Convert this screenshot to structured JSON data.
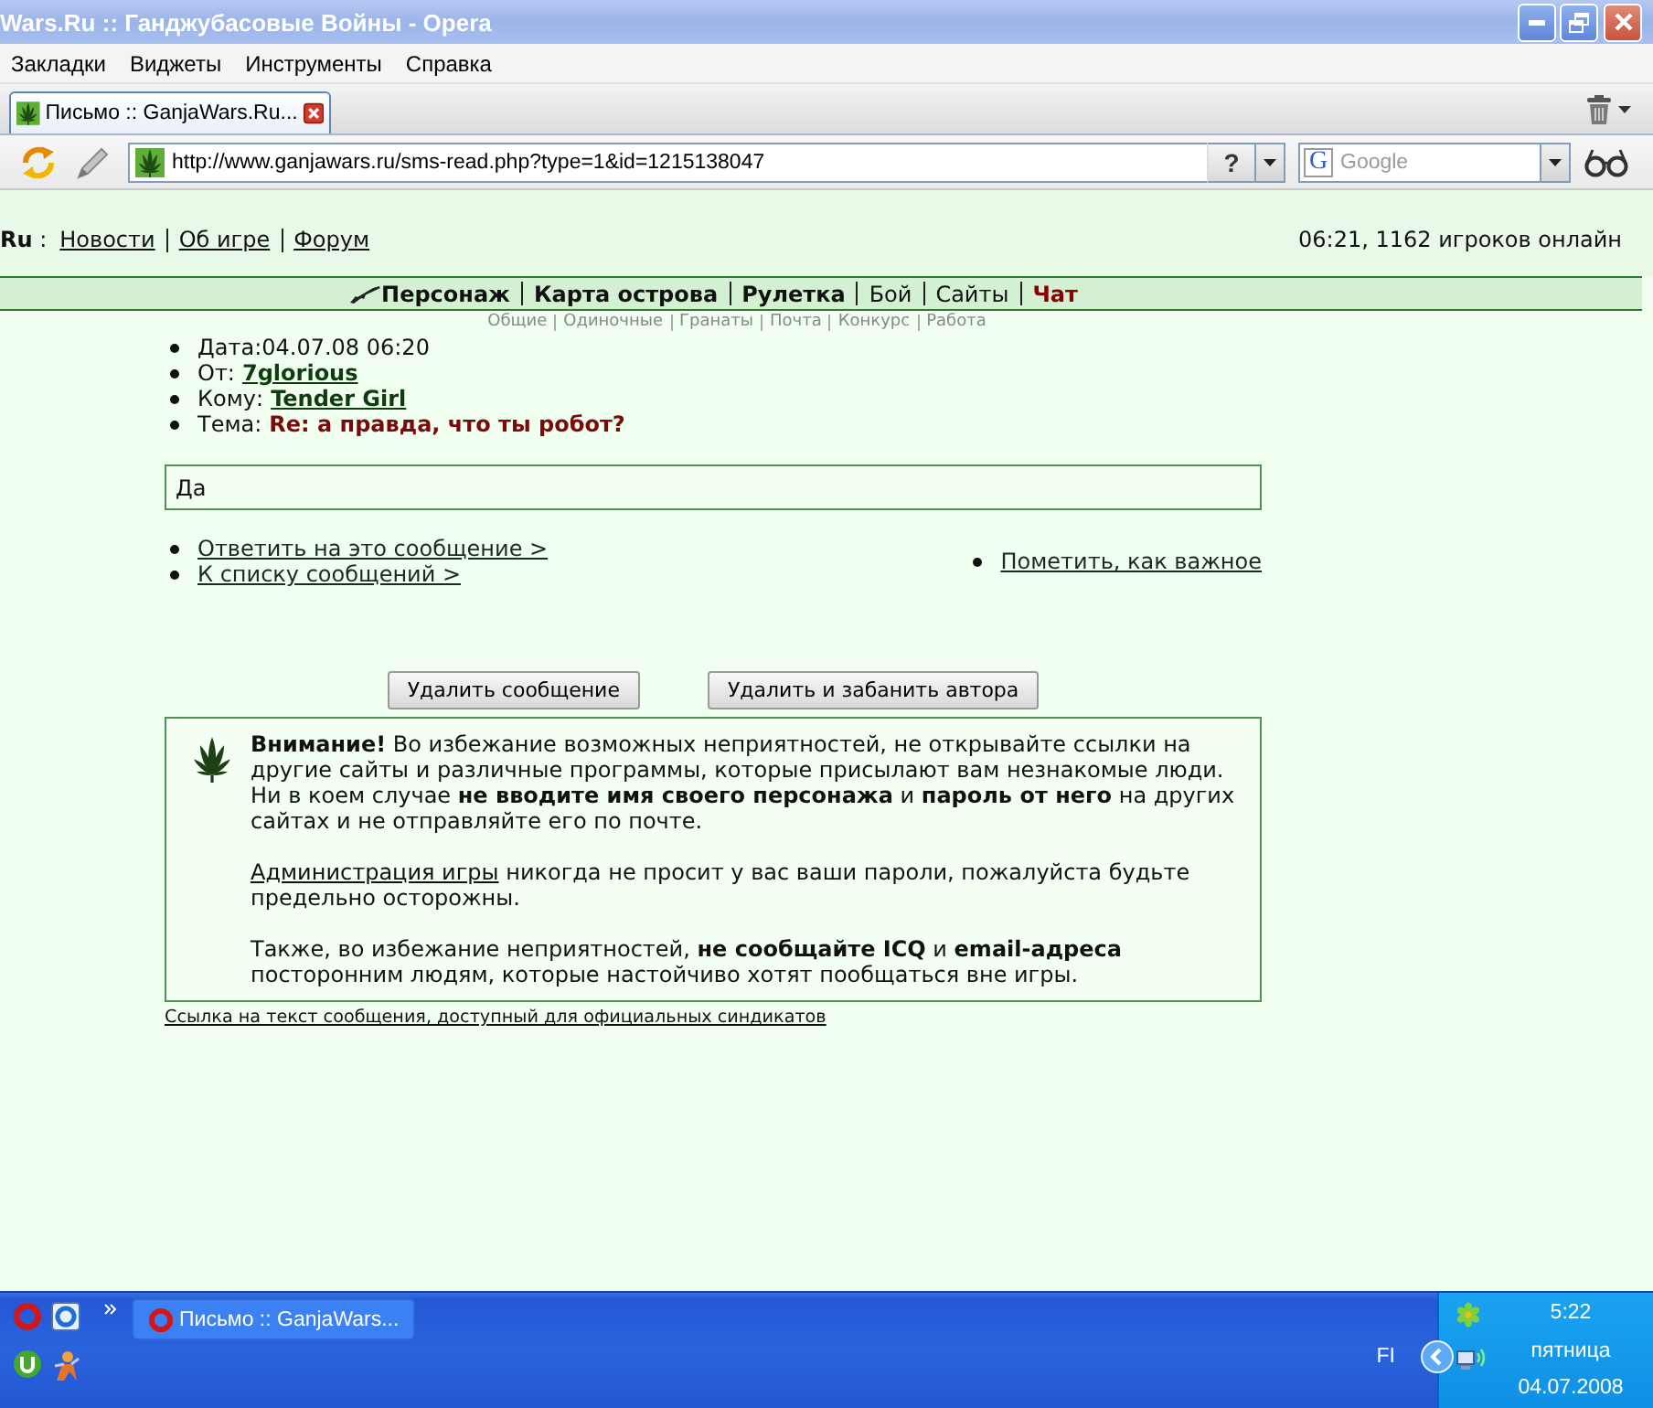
{
  "window": {
    "title": "Wars.Ru :: Ганджубасовые Войны - Opera",
    "active": false
  },
  "menu": [
    "Закладки",
    "Виджеты",
    "Инструменты",
    "Справка"
  ],
  "tabs": [
    {
      "label": "Письмо :: GanjaWars.Ru...",
      "selected": true
    }
  ],
  "address_bar": {
    "url": "http://www.ganjawars.ru/sms-read.php?type=1&id=1215138047",
    "help_button": "?"
  },
  "search": {
    "logo": "G",
    "placeholder": "Google"
  },
  "header": {
    "site": "**Ru** :",
    "links": [
      "Новости",
      "Об игре",
      "Форум"
    ],
    "status": "06:21, 1162 игроков онлайн"
  },
  "nav": {
    "items": [
      {
        "label": "Персонаж",
        "kind": "bold"
      },
      {
        "label": "Карта острова",
        "kind": "bold"
      },
      {
        "label": "Рулетка",
        "kind": "bold"
      },
      {
        "label": "Бой",
        "kind": "plain"
      },
      {
        "label": "Сайты",
        "kind": "plain"
      },
      {
        "label": "Чат",
        "kind": "alert"
      }
    ],
    "subitems": [
      "Общие",
      "Одиночные",
      "Гранаты",
      "Почта",
      "Конкурс",
      "Работа"
    ]
  },
  "message": {
    "fields": [
      {
        "kind": "plain",
        "text": "Дата:04.07.08 06:20"
      },
      {
        "kind": "user",
        "label": "От:",
        "value": "7glorious"
      },
      {
        "kind": "user",
        "label": "Кому:",
        "value": "Tender Girl"
      },
      {
        "kind": "subject",
        "label": "Тема:",
        "value": "Re: а правда, что ты робот?"
      }
    ],
    "body": "Да"
  },
  "actions": {
    "left": [
      "Ответить на это сообщение >",
      "К списку сообщений >"
    ],
    "right": [
      "Пометить, как важное"
    ]
  },
  "buttons": [
    "Удалить сообщение",
    "Удалить и забанить автора"
  ],
  "warning": {
    "paragraphs": [
      {
        "text": "**Внимание!** Во избежание возможных неприятностей, не открывайте ссылки на другие сайты и различные программы, которые присылают вам незнакомые люди. Ни в коем случае **не вводите имя своего персонажа** и **пароль от него** на других сайтах и не отправляйте его по почте."
      },
      {
        "link": "Администрация игры",
        "text": "никогда не просит у вас ваши пароли, пожалуйста будьте предельно осторожны."
      },
      {
        "text": "Также, во избежание неприятностей, **не сообщайте ICQ** и **email-адреса** посторонним людям, которые настойчиво хотят пообщаться вне игры."
      }
    ]
  },
  "footer_link": "Ссылка на текст сообщения, доступный для официальных синдикатов",
  "taskbar": {
    "tasks": [
      {
        "label": "Письмо :: GanjaWars...",
        "selected": false
      }
    ],
    "tray": {
      "language": "FI",
      "time": "5:22",
      "day": "пятница",
      "date": "04.07.2008"
    }
  }
}
